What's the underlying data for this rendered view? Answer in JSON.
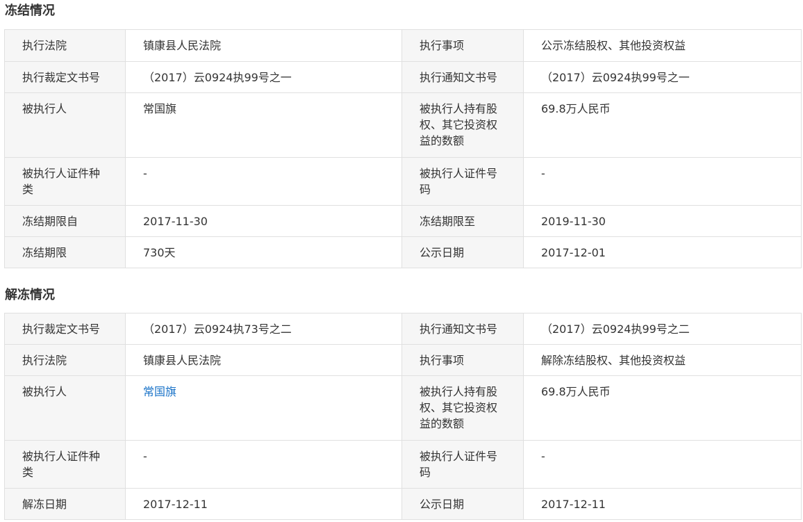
{
  "freeze": {
    "title": "冻结情况",
    "rows": [
      [
        {
          "label": "执行法院",
          "value": "镇康县人民法院"
        },
        {
          "label": "执行事项",
          "value": "公示冻结股权、其他投资权益"
        }
      ],
      [
        {
          "label": "执行裁定文书号",
          "value": "（2017）云0924执99号之一"
        },
        {
          "label": "执行通知文书号",
          "value": "（2017）云0924执99号之一"
        }
      ],
      [
        {
          "label": "被执行人",
          "value": "常国旗"
        },
        {
          "label": "被执行人持有股权、其它投资权益的数额",
          "value": "69.8万人民币"
        }
      ],
      [
        {
          "label": "被执行人证件种类",
          "value": "-"
        },
        {
          "label": "被执行人证件号码",
          "value": "-"
        }
      ],
      [
        {
          "label": "冻结期限自",
          "value": "2017-11-30"
        },
        {
          "label": "冻结期限至",
          "value": "2019-11-30"
        }
      ],
      [
        {
          "label": "冻结期限",
          "value": "730天"
        },
        {
          "label": "公示日期",
          "value": "2017-12-01"
        }
      ]
    ]
  },
  "unfreeze": {
    "title": "解冻情况",
    "rows": [
      [
        {
          "label": "执行裁定文书号",
          "value": "（2017）云0924执73号之二"
        },
        {
          "label": "执行通知文书号",
          "value": "（2017）云0924执99号之二"
        }
      ],
      [
        {
          "label": "执行法院",
          "value": "镇康县人民法院"
        },
        {
          "label": "执行事项",
          "value": "解除冻结股权、其他投资权益"
        }
      ],
      [
        {
          "label": "被执行人",
          "value": "常国旗",
          "link": true
        },
        {
          "label": "被执行人持有股权、其它投资权益的数额",
          "value": "69.8万人民币"
        }
      ],
      [
        {
          "label": "被执行人证件种类",
          "value": "-"
        },
        {
          "label": "被执行人证件号码",
          "value": "-"
        }
      ],
      [
        {
          "label": "解冻日期",
          "value": "2017-12-11"
        },
        {
          "label": "公示日期",
          "value": "2017-12-11"
        }
      ]
    ]
  },
  "colors": {
    "label_bg": "#f6f6f6",
    "border": "#e0e0e0",
    "link": "#1a73c8",
    "text": "#333333"
  }
}
